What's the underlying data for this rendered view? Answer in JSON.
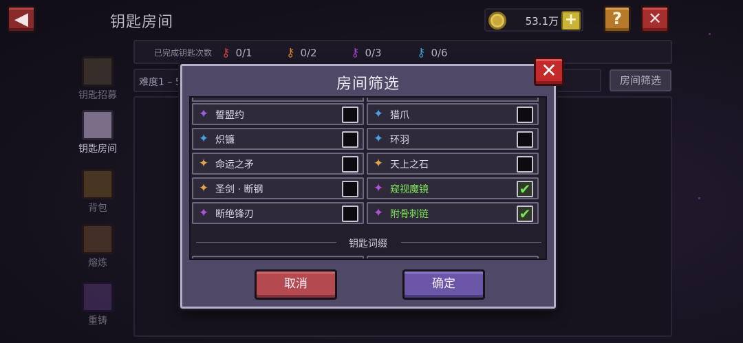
{
  "header": {
    "back_icon": "arrow-left-icon",
    "title": "钥匙房间",
    "coin_icon": "gold-coin-icon",
    "coins": "53.1万",
    "plus": "+",
    "help": "?",
    "close": "✕"
  },
  "key_counts": {
    "label": "已完成钥匙次数",
    "items": [
      {
        "icon": "red-key-icon",
        "color": "#d64545",
        "value": "0/1"
      },
      {
        "icon": "orange-key-icon",
        "color": "#d9882d",
        "value": "0/2"
      },
      {
        "icon": "purple-key-icon",
        "color": "#a040c8",
        "value": "0/3"
      },
      {
        "icon": "cyan-key-icon",
        "color": "#3aa0c8",
        "value": "0/6"
      }
    ]
  },
  "background": {
    "difficulty": "难度1 – 5",
    "filter_button": "房间筛选"
  },
  "sidebar": {
    "items": [
      {
        "label": "钥匙招募",
        "icon": "shrine-icon",
        "active": false
      },
      {
        "label": "钥匙房间",
        "icon": "key-room-icon",
        "active": true
      },
      {
        "label": "背包",
        "icon": "bag-icon",
        "active": false
      },
      {
        "label": "熔炼",
        "icon": "furnace-icon",
        "active": false
      },
      {
        "label": "重铸",
        "icon": "reforge-icon",
        "active": false
      }
    ]
  },
  "modal": {
    "title": "房间筛选",
    "close": "✕",
    "rows": [
      {
        "left": {
          "name": "誓盟约",
          "icon": "purple-crystal-icon",
          "color": "#9a5ee6",
          "checked": false
        },
        "right": {
          "name": "猎爪",
          "icon": "blue-claw-icon",
          "color": "#4aa0e6",
          "checked": false
        }
      },
      {
        "left": {
          "name": "炽镰",
          "icon": "blue-sickle-icon",
          "color": "#4aa0e6",
          "checked": false
        },
        "right": {
          "name": "环羽",
          "icon": "blue-feather-icon",
          "color": "#4aa0e6",
          "checked": false
        }
      },
      {
        "left": {
          "name": "命运之矛",
          "icon": "gold-spear-icon",
          "color": "#e6a24a",
          "checked": false
        },
        "right": {
          "name": "天上之石",
          "icon": "gold-stone-icon",
          "color": "#e6a24a",
          "checked": false
        }
      },
      {
        "left": {
          "name": "圣剑 · 断钢",
          "icon": "gold-sword-icon",
          "color": "#e6a24a",
          "checked": false
        },
        "right": {
          "name": "窥视魔镜",
          "icon": "purple-mirror-icon",
          "color": "#b052d6",
          "checked": true
        }
      },
      {
        "left": {
          "name": "断绝锋刃",
          "icon": "purple-blade-icon",
          "color": "#b052d6",
          "checked": false
        },
        "right": {
          "name": "附骨刺链",
          "icon": "purple-chain-icon",
          "color": "#b052d6",
          "checked": true
        }
      }
    ],
    "section_label": "钥匙词缀",
    "cancel": "取消",
    "confirm": "确定"
  }
}
